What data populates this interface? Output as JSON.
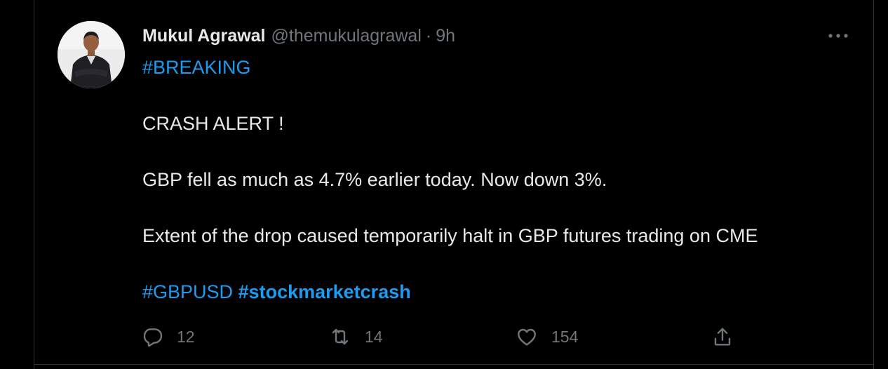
{
  "tweet": {
    "author_name": "Mukul Agrawal",
    "author_handle": "@themukulagrawal",
    "separator": "·",
    "timestamp": "9h",
    "body": {
      "hashtag_breaking": "#BREAKING",
      "line_alert": "CRASH ALERT !",
      "line_gbp": "GBP fell as much as 4.7% earlier today. Now down 3%.",
      "line_extent": "Extent of the drop caused temporarily halt in GBP futures trading on CME",
      "hashtag_gbpusd": "#GBPUSD",
      "hashtag_crash": "#stockmarketcrash"
    },
    "actions": {
      "reply_icon": "reply-icon",
      "reply_count": "12",
      "retweet_icon": "retweet-icon",
      "retweet_count": "14",
      "like_icon": "heart-icon",
      "like_count": "154",
      "share_icon": "share-icon"
    },
    "more_icon": "more-options-icon"
  },
  "colors": {
    "background": "#000000",
    "text_primary": "#e7e9ea",
    "text_secondary": "#71767b",
    "accent": "#1d9bf0",
    "border": "#2f3336"
  }
}
